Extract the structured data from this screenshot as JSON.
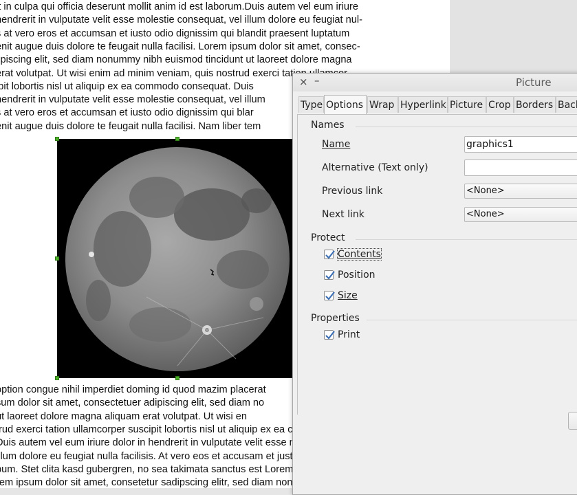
{
  "document": {
    "lines_top": [
      "it in culpa qui officia deserunt mollit anim id est laborum.Duis autem vel eum iriure",
      "hendrerit in vulputate velit esse molestie consequat, vel illum dolore eu feugiat nul-",
      "s at vero eros et accumsan et iusto odio dignissim qui blandit praesent luptatum",
      "enit augue duis dolore te feugait nulla facilisi. Lorem ipsum dolor sit amet, consec-",
      "lipiscing elit, sed diam nonummy nibh euismod tincidunt ut laoreet dolore magna",
      "erat volutpat. Ut wisi enim ad minim veniam, quis nostrud exerci tation ullamcor-",
      "ipit lobortis nisl ut aliquip ex ea commodo consequat. Duis",
      "hendrerit in vulputate velit esse molestie consequat, vel illum",
      "s at vero eros et accumsan et iusto odio dignissim qui blar",
      "enit augue duis dolore te feugait nulla facilisi. Nam liber tem"
    ],
    "lines_bottom": [
      "option congue nihil imperdiet doming id quod mazim placerat",
      "sum dolor sit amet, consectetuer adipiscing elit, sed diam no",
      " ut laoreet dolore magna aliquam erat volutpat. Ut wisi en",
      "trud exerci tation ullamcorper suscipit lobortis nisl ut aliquip ex ea commodo con-",
      "Duis autem vel eum iriure dolor in hendrerit in vulputate velit esse molestie conse-",
      " illum dolore eu feugiat nulla facilisis. At vero eos et accusam et justo duo dolores",
      "bum. Stet clita kasd gubergren, no sea takimata sanctus est Lorem ipsum dolor sit",
      "rem ipsum dolor sit amet, consetetur sadipscing elitr, sed diam nonumy eirmod"
    ]
  },
  "dialog": {
    "title": "Picture",
    "close_icon": "×",
    "minimize_icon": "–",
    "tabs": [
      "Type",
      "Options",
      "Wrap",
      "Hyperlink",
      "Picture",
      "Crop",
      "Borders",
      "Back"
    ],
    "active_tab": "Options",
    "names": {
      "section": "Names",
      "name_label": "Name",
      "name_value": "graphics1",
      "alt_label": "Alternative (Text only)",
      "alt_value": "",
      "prev_label": "Previous link",
      "prev_value": "<None>",
      "next_label": "Next link",
      "next_value": "<None>"
    },
    "protect": {
      "section": "Protect",
      "contents": "Contents",
      "position": "Position",
      "size": "Size",
      "contents_checked": true,
      "position_checked": true,
      "size_checked": true
    },
    "properties": {
      "section": "Properties",
      "print": "Print",
      "print_checked": true
    }
  },
  "colors": {
    "selection_handle": "#4caf28",
    "check": "#3d6fb5"
  }
}
